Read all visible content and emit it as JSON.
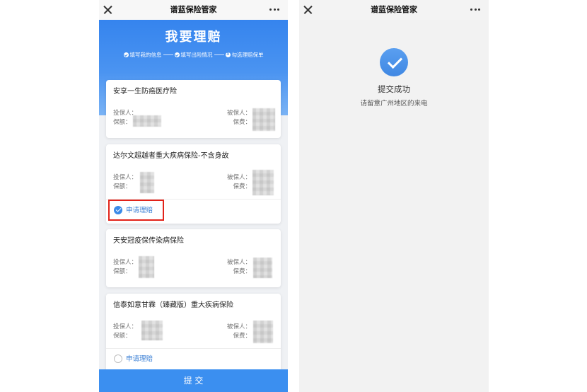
{
  "left_screen": {
    "topbar": {
      "title": "谱蓝保险管家",
      "close_icon": "close-icon",
      "more_icon": "more-icon"
    },
    "header": {
      "title": "我要理赔",
      "steps": [
        {
          "label": "填写我的信息",
          "completed": true,
          "icon": "check-icon"
        },
        {
          "label": "填写出险情况",
          "completed": true,
          "icon": "check-icon"
        },
        {
          "label": "勾选理赔保单",
          "completed": false,
          "number": "3"
        }
      ]
    },
    "field_labels": {
      "policyholder": "投保人：",
      "sum_insured": "保额：",
      "insured": "被保人：",
      "premium": "保费："
    },
    "policies": [
      {
        "name": "安享一生防癌医疗险"
      },
      {
        "name": "达尔文超越者重大疾病保险-不含身故",
        "apply": {
          "label": "申请理赔",
          "checked": true,
          "highlighted": true
        }
      },
      {
        "name": "天安冠疫保传染病保险"
      },
      {
        "name": "信泰如意甘霖（臻藏版）重大疾病保险",
        "apply": {
          "label": "申请理赔",
          "checked": false,
          "highlighted": false
        }
      }
    ],
    "submit_label": "提 交"
  },
  "right_screen": {
    "topbar": {
      "title": "谱蓝保险管家",
      "close_icon": "close-icon",
      "more_icon": "more-icon"
    },
    "result": {
      "icon": "success-check-icon",
      "title": "提交成功",
      "message": "请留意广州地区的来电"
    }
  },
  "colors": {
    "brand_blue": "#3b8ff0",
    "check_blue": "#3a8ae8",
    "highlight_red": "#e2231a",
    "page_bg": "#eff1f4"
  }
}
